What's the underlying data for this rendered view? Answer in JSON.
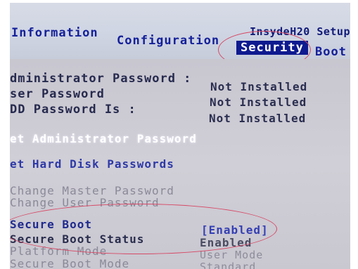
{
  "header": {
    "brand": "InsydeH20 Setup",
    "tabs": [
      {
        "label": "Information"
      },
      {
        "label": "Configuration"
      },
      {
        "label": "Security"
      },
      {
        "label": "Boot"
      }
    ],
    "active_tab": "Security"
  },
  "passwords": {
    "admin_label": "dministrator Password :",
    "admin_value": "Not Installed",
    "user_label": "ser Password",
    "user_value": "Not Installed",
    "hdd_label": "DD Password Is :",
    "hdd_value": "Not Installed"
  },
  "actions": {
    "set_admin": "et Administrator Password",
    "set_hdd": "et Hard Disk Passwords",
    "change_master": "Change Master Password",
    "change_user": "Change User Password"
  },
  "secure_boot": {
    "label": "Secure Boot",
    "value": "[Enabled]",
    "status_label": "Secure Boot Status",
    "status_value": "Enabled",
    "platform_label": "Platform Mode",
    "platform_value": "User Mode",
    "mode_label": "Secure Boot Mode",
    "mode_value": "Standard"
  },
  "colors": {
    "header_text": "#14209a",
    "active_tab_bg": "#0e1a8f",
    "annotation": "#d64a66",
    "link_text": "#2e39a8"
  }
}
